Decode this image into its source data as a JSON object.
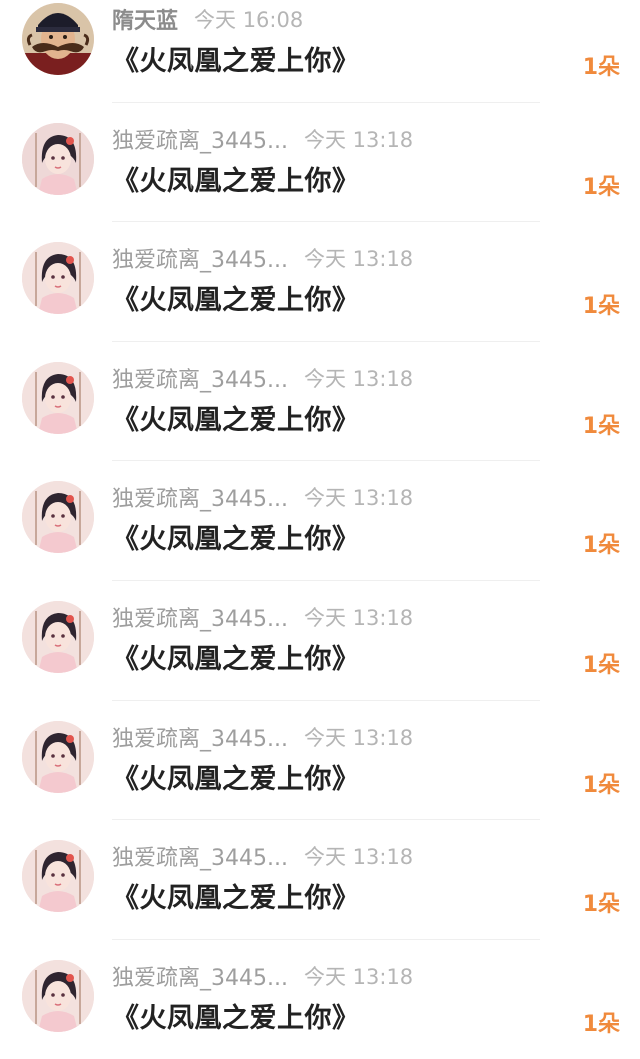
{
  "colors": {
    "accent": "#f08a3c",
    "title_text": "#222222",
    "meta_text": "#9e9e9e",
    "divider": "#efefef"
  },
  "items": [
    {
      "avatar": "mustache-man-avatar",
      "name": "隋天蓝",
      "time": "今天 16:08",
      "text": "《火凤凰之爱上你》",
      "count": "1朵"
    },
    {
      "avatar": "anime-girl-avatar",
      "name": "独爱疏离_3445...",
      "time": "今天 13:18",
      "text": "《火凤凰之爱上你》",
      "count": "1朵"
    },
    {
      "avatar": "anime-girl-avatar",
      "name": "独爱疏离_3445...",
      "time": "今天 13:18",
      "text": "《火凤凰之爱上你》",
      "count": "1朵"
    },
    {
      "avatar": "anime-girl-avatar",
      "name": "独爱疏离_3445...",
      "time": "今天 13:18",
      "text": "《火凤凰之爱上你》",
      "count": "1朵"
    },
    {
      "avatar": "anime-girl-avatar",
      "name": "独爱疏离_3445...",
      "time": "今天 13:18",
      "text": "《火凤凰之爱上你》",
      "count": "1朵"
    },
    {
      "avatar": "anime-girl-avatar",
      "name": "独爱疏离_3445...",
      "time": "今天 13:18",
      "text": "《火凤凰之爱上你》",
      "count": "1朵"
    },
    {
      "avatar": "anime-girl-avatar",
      "name": "独爱疏离_3445...",
      "time": "今天 13:18",
      "text": "《火凤凰之爱上你》",
      "count": "1朵"
    },
    {
      "avatar": "anime-girl-avatar",
      "name": "独爱疏离_3445...",
      "time": "今天 13:18",
      "text": "《火凤凰之爱上你》",
      "count": "1朵"
    },
    {
      "avatar": "anime-girl-avatar",
      "name": "独爱疏离_3445...",
      "time": "今天 13:18",
      "text": "《火凤凰之爱上你》",
      "count": "1朵"
    }
  ]
}
